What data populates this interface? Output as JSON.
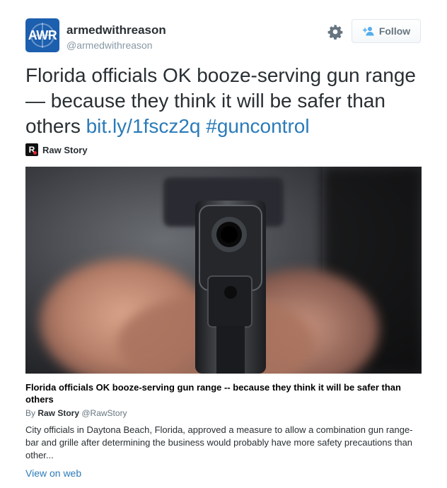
{
  "user": {
    "display_name": "armedwithreason",
    "screen_name": "@armedwithreason",
    "avatar_text": "AWR"
  },
  "actions": {
    "follow_label": "Follow",
    "settings_icon": "gear-icon",
    "follow_icon": "person-plus-icon"
  },
  "tweet": {
    "text": "Florida officials OK booze-serving gun range — because they think it will be safer than others ",
    "link": "bit.ly/1fscz2q",
    "hashtag": "#guncontrol"
  },
  "card": {
    "source_logo_text": "R",
    "source_name": "Raw Story",
    "image": "close-up photo of a handgun pointed at the viewer",
    "title": "Florida officials OK booze-serving gun range -- because they think it will be safer than others",
    "byline_prefix": "By ",
    "byline_author": "Raw Story",
    "byline_handle": " @RawStory",
    "description": "City officials in Daytona Beach, Florida, approved a measure to allow a combination gun range-bar and grille after determining the business would probably have more safety precautions than other...",
    "view_on_web": "View on web"
  },
  "colors": {
    "link": "#2b7bb9",
    "text": "#292f33",
    "muted": "#8899a6",
    "avatar_bg": "#1c5fae"
  }
}
